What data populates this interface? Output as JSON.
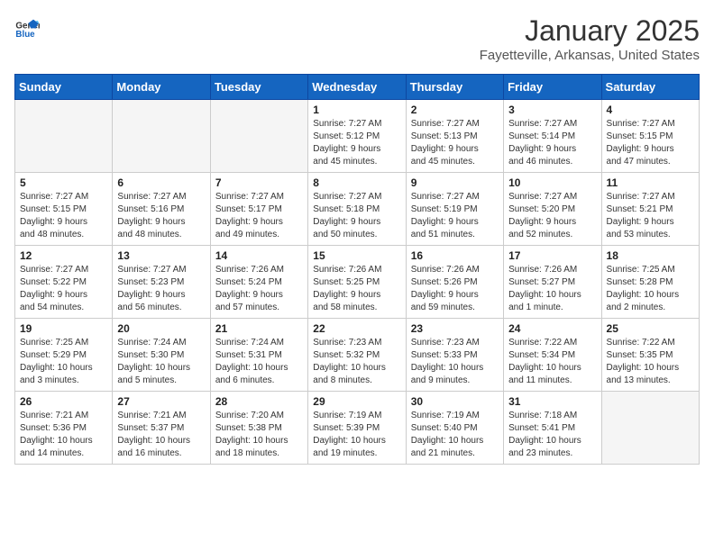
{
  "header": {
    "logo_general": "General",
    "logo_blue": "Blue",
    "month_title": "January 2025",
    "subtitle": "Fayetteville, Arkansas, United States"
  },
  "weekdays": [
    "Sunday",
    "Monday",
    "Tuesday",
    "Wednesday",
    "Thursday",
    "Friday",
    "Saturday"
  ],
  "weeks": [
    [
      {
        "day": "",
        "info": ""
      },
      {
        "day": "",
        "info": ""
      },
      {
        "day": "",
        "info": ""
      },
      {
        "day": "1",
        "info": "Sunrise: 7:27 AM\nSunset: 5:12 PM\nDaylight: 9 hours\nand 45 minutes."
      },
      {
        "day": "2",
        "info": "Sunrise: 7:27 AM\nSunset: 5:13 PM\nDaylight: 9 hours\nand 45 minutes."
      },
      {
        "day": "3",
        "info": "Sunrise: 7:27 AM\nSunset: 5:14 PM\nDaylight: 9 hours\nand 46 minutes."
      },
      {
        "day": "4",
        "info": "Sunrise: 7:27 AM\nSunset: 5:15 PM\nDaylight: 9 hours\nand 47 minutes."
      }
    ],
    [
      {
        "day": "5",
        "info": "Sunrise: 7:27 AM\nSunset: 5:15 PM\nDaylight: 9 hours\nand 48 minutes."
      },
      {
        "day": "6",
        "info": "Sunrise: 7:27 AM\nSunset: 5:16 PM\nDaylight: 9 hours\nand 48 minutes."
      },
      {
        "day": "7",
        "info": "Sunrise: 7:27 AM\nSunset: 5:17 PM\nDaylight: 9 hours\nand 49 minutes."
      },
      {
        "day": "8",
        "info": "Sunrise: 7:27 AM\nSunset: 5:18 PM\nDaylight: 9 hours\nand 50 minutes."
      },
      {
        "day": "9",
        "info": "Sunrise: 7:27 AM\nSunset: 5:19 PM\nDaylight: 9 hours\nand 51 minutes."
      },
      {
        "day": "10",
        "info": "Sunrise: 7:27 AM\nSunset: 5:20 PM\nDaylight: 9 hours\nand 52 minutes."
      },
      {
        "day": "11",
        "info": "Sunrise: 7:27 AM\nSunset: 5:21 PM\nDaylight: 9 hours\nand 53 minutes."
      }
    ],
    [
      {
        "day": "12",
        "info": "Sunrise: 7:27 AM\nSunset: 5:22 PM\nDaylight: 9 hours\nand 54 minutes."
      },
      {
        "day": "13",
        "info": "Sunrise: 7:27 AM\nSunset: 5:23 PM\nDaylight: 9 hours\nand 56 minutes."
      },
      {
        "day": "14",
        "info": "Sunrise: 7:26 AM\nSunset: 5:24 PM\nDaylight: 9 hours\nand 57 minutes."
      },
      {
        "day": "15",
        "info": "Sunrise: 7:26 AM\nSunset: 5:25 PM\nDaylight: 9 hours\nand 58 minutes."
      },
      {
        "day": "16",
        "info": "Sunrise: 7:26 AM\nSunset: 5:26 PM\nDaylight: 9 hours\nand 59 minutes."
      },
      {
        "day": "17",
        "info": "Sunrise: 7:26 AM\nSunset: 5:27 PM\nDaylight: 10 hours\nand 1 minute."
      },
      {
        "day": "18",
        "info": "Sunrise: 7:25 AM\nSunset: 5:28 PM\nDaylight: 10 hours\nand 2 minutes."
      }
    ],
    [
      {
        "day": "19",
        "info": "Sunrise: 7:25 AM\nSunset: 5:29 PM\nDaylight: 10 hours\nand 3 minutes."
      },
      {
        "day": "20",
        "info": "Sunrise: 7:24 AM\nSunset: 5:30 PM\nDaylight: 10 hours\nand 5 minutes."
      },
      {
        "day": "21",
        "info": "Sunrise: 7:24 AM\nSunset: 5:31 PM\nDaylight: 10 hours\nand 6 minutes."
      },
      {
        "day": "22",
        "info": "Sunrise: 7:23 AM\nSunset: 5:32 PM\nDaylight: 10 hours\nand 8 minutes."
      },
      {
        "day": "23",
        "info": "Sunrise: 7:23 AM\nSunset: 5:33 PM\nDaylight: 10 hours\nand 9 minutes."
      },
      {
        "day": "24",
        "info": "Sunrise: 7:22 AM\nSunset: 5:34 PM\nDaylight: 10 hours\nand 11 minutes."
      },
      {
        "day": "25",
        "info": "Sunrise: 7:22 AM\nSunset: 5:35 PM\nDaylight: 10 hours\nand 13 minutes."
      }
    ],
    [
      {
        "day": "26",
        "info": "Sunrise: 7:21 AM\nSunset: 5:36 PM\nDaylight: 10 hours\nand 14 minutes."
      },
      {
        "day": "27",
        "info": "Sunrise: 7:21 AM\nSunset: 5:37 PM\nDaylight: 10 hours\nand 16 minutes."
      },
      {
        "day": "28",
        "info": "Sunrise: 7:20 AM\nSunset: 5:38 PM\nDaylight: 10 hours\nand 18 minutes."
      },
      {
        "day": "29",
        "info": "Sunrise: 7:19 AM\nSunset: 5:39 PM\nDaylight: 10 hours\nand 19 minutes."
      },
      {
        "day": "30",
        "info": "Sunrise: 7:19 AM\nSunset: 5:40 PM\nDaylight: 10 hours\nand 21 minutes."
      },
      {
        "day": "31",
        "info": "Sunrise: 7:18 AM\nSunset: 5:41 PM\nDaylight: 10 hours\nand 23 minutes."
      },
      {
        "day": "",
        "info": ""
      }
    ]
  ]
}
